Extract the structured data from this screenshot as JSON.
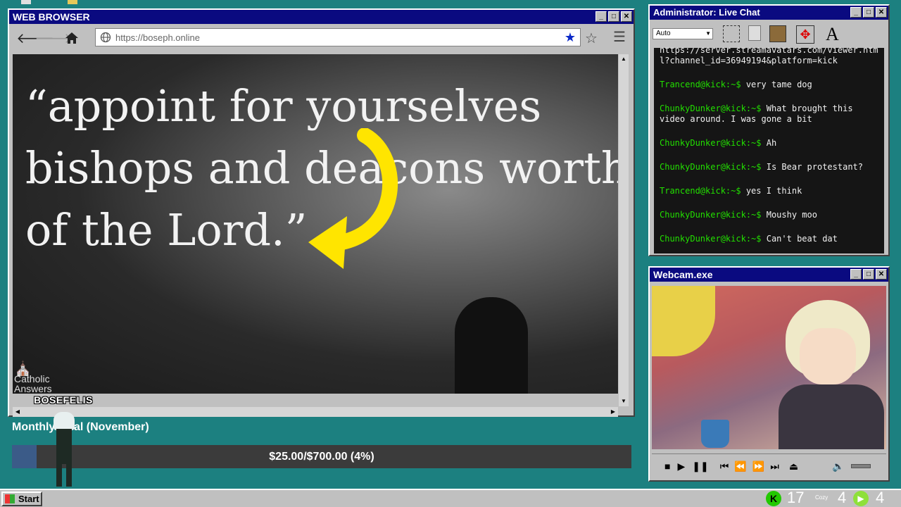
{
  "browser": {
    "title": "WEB BROWSER",
    "url": "https://boseph.online",
    "quote_lines": [
      "“appoint for yourselves",
      "bishops and deacons worth",
      "of the Lord.”"
    ],
    "watermark_line1": "Catholic",
    "watermark_line2": "Answers"
  },
  "streamer_tag": "BOSEFELIS",
  "chat": {
    "title": "Administrator: Live Chat",
    "font_size_value": "Auto",
    "messages": [
      {
        "user": "",
        "text": "https://server.streamavatars.com/viewer.html?channel_id=36949194&platform=kick"
      },
      {
        "user": "Trancend@kick:~$",
        "text": "very tame dog"
      },
      {
        "user": "ChunkyDunker@kick:~$",
        "text": "What brought this video around. I was gone a bit"
      },
      {
        "user": "ChunkyDunker@kick:~$",
        "text": "Ah"
      },
      {
        "user": "ChunkyDunker@kick:~$",
        "text": "Is Bear protestant?"
      },
      {
        "user": "Trancend@kick:~$",
        "text": "yes I think"
      },
      {
        "user": "ChunkyDunker@kick:~$",
        "text": "Moushy moo"
      },
      {
        "user": "ChunkyDunker@kick:~$",
        "text": "Can't beat dat"
      }
    ]
  },
  "webcam": {
    "title": "Webcam.exe"
  },
  "goal": {
    "label": "Monthly Goal (November)",
    "amount_text": "$25.00/$700.00 (4%)",
    "progress": 0.04
  },
  "taskbar": {
    "start_label": "Start",
    "count1": "17",
    "count2": "4",
    "count3": "4",
    "cozy_label": "Cozy"
  },
  "colors": {
    "titlebar": "#0a0a80",
    "desktop": "#1c8080",
    "chat_user": "#22e000",
    "quote_arrow": "#ffe500"
  }
}
